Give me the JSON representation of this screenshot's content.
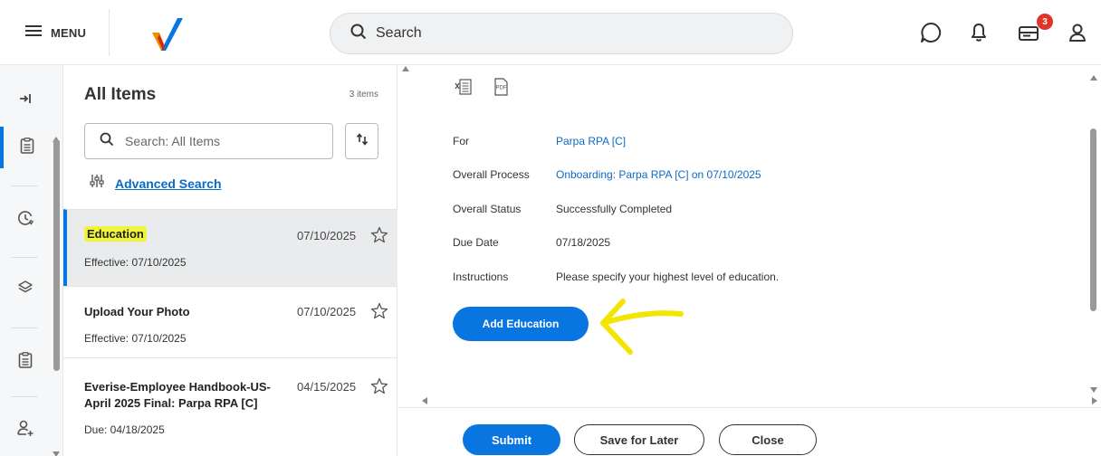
{
  "topbar": {
    "menu_label": "MENU",
    "search_placeholder": "Search",
    "notification_count": "3",
    "icons": [
      "menu-icon",
      "workday-logo",
      "search-icon",
      "chat-icon",
      "bell-icon",
      "inbox-icon",
      "profile-icon"
    ],
    "accent_color": "#0875e1",
    "badge_color": "#e0342a"
  },
  "rail": {
    "icons": [
      "expand-icon",
      "clipboard-icon",
      "clock-icon",
      "layers-icon",
      "clipboard-icon",
      "add-user-icon"
    ]
  },
  "panel": {
    "title": "All Items",
    "count": "3 items",
    "search_placeholder": "Search: All Items",
    "advanced_search": "Advanced Search",
    "items": [
      {
        "title": "Education",
        "subtitle": "Effective: 07/10/2025",
        "date": "07/10/2025",
        "selected": true
      },
      {
        "title": "Upload Your Photo",
        "subtitle": "Effective: 07/10/2025",
        "date": "07/10/2025",
        "selected": false
      },
      {
        "title_line1": "Everise-Employee Handbook-US-",
        "title_line2": "April 2025 Final: Parpa RPA [C]",
        "subtitle": "Due: 04/18/2025",
        "date": "04/15/2025",
        "selected": false
      }
    ]
  },
  "detail": {
    "export_icons": [
      "excel-export-icon",
      "pdf-export-icon"
    ],
    "fields": [
      {
        "label": "For",
        "value": "Parpa RPA [C]",
        "link": true
      },
      {
        "label": "Overall Process",
        "value": "Onboarding: Parpa RPA [C] on 07/10/2025",
        "link": true
      },
      {
        "label": "Overall Status",
        "value": "Successfully Completed",
        "link": false
      },
      {
        "label": "Due Date",
        "value": "07/18/2025",
        "link": false
      },
      {
        "label": "Instructions",
        "value": "Please specify your highest level of education.",
        "link": false
      }
    ],
    "add_button": "Add Education"
  },
  "actions": {
    "submit": "Submit",
    "save_for_later": "Save for Later",
    "close": "Close"
  }
}
